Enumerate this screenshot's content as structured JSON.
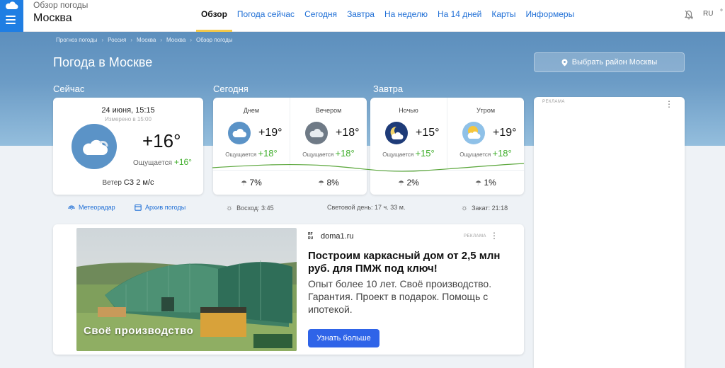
{
  "header": {
    "subtitle": "Обзор погоды",
    "city": "Москва",
    "lang": "RU",
    "unit": "°",
    "tabs": [
      {
        "label": "Обзор"
      },
      {
        "label": "Погода сейчас"
      },
      {
        "label": "Сегодня"
      },
      {
        "label": "Завтра"
      },
      {
        "label": "На неделю"
      },
      {
        "label": "На 14 дней"
      },
      {
        "label": "Карты"
      },
      {
        "label": "Информеры"
      }
    ]
  },
  "breadcrumb": [
    "Прогноз погоды",
    "Россия",
    "Москва",
    "Москва",
    "Обзор погоды"
  ],
  "page_title": "Погода в Москве",
  "district_button": "Выбрать район Москвы",
  "sections": {
    "now": "Сейчас",
    "today": "Сегодня",
    "tomorrow": "Завтра"
  },
  "now": {
    "date": "24 июня, 15:15",
    "measured": "Измерено в 15:00",
    "temp": "+16°",
    "feels_label": "Ощущается",
    "feels": "+16°",
    "wind_label": "Ветер",
    "wind": "СЗ 2 м/с",
    "icon": "cloudy-icon"
  },
  "today": [
    {
      "label": "Днем",
      "temp": "+19°",
      "feels_label": "Ощущается",
      "feels": "+18°",
      "rain": "7%",
      "icon": "cloudy-icon"
    },
    {
      "label": "Вечером",
      "temp": "+18°",
      "feels_label": "Ощущается",
      "feels": "+18°",
      "rain": "8%",
      "icon": "cloudy-icon"
    }
  ],
  "tomorrow": [
    {
      "label": "Ночью",
      "temp": "+15°",
      "feels_label": "Ощущается",
      "feels": "+15°",
      "rain": "2%",
      "icon": "moon-cloud-icon"
    },
    {
      "label": "Утром",
      "temp": "+19°",
      "feels_label": "Ощущается",
      "feels": "+18°",
      "rain": "1%",
      "icon": "sun-cloud-icon"
    }
  ],
  "info": {
    "radar": "Метеорадар",
    "archive": "Архив погоды",
    "sunrise": "Восход: 3:45",
    "daylight": "Световой день: 17 ч. 33 м.",
    "sunset": "Закат: 21:18"
  },
  "side_ad": {
    "tag": "РЕКЛАМА"
  },
  "ad": {
    "logo": "RF RU",
    "domain": "doma1.ru",
    "tag": "РЕКЛАМА",
    "photo_caption": "Своё производство",
    "headline": "Построим каркасный дом от 2,5 млн руб. для ПМЖ под ключ!",
    "body": "Опыт более 10 лет. Своё производство. Гарантия. Проект в подарок. Помощь с ипотекой.",
    "cta": "Узнать больше"
  },
  "colors": {
    "accent": "#1f6fd6",
    "brand": "#1f7ee3",
    "feels": "#3fae2a",
    "cta": "#2f64e8",
    "active_tab_underline": "#f3c84a"
  }
}
